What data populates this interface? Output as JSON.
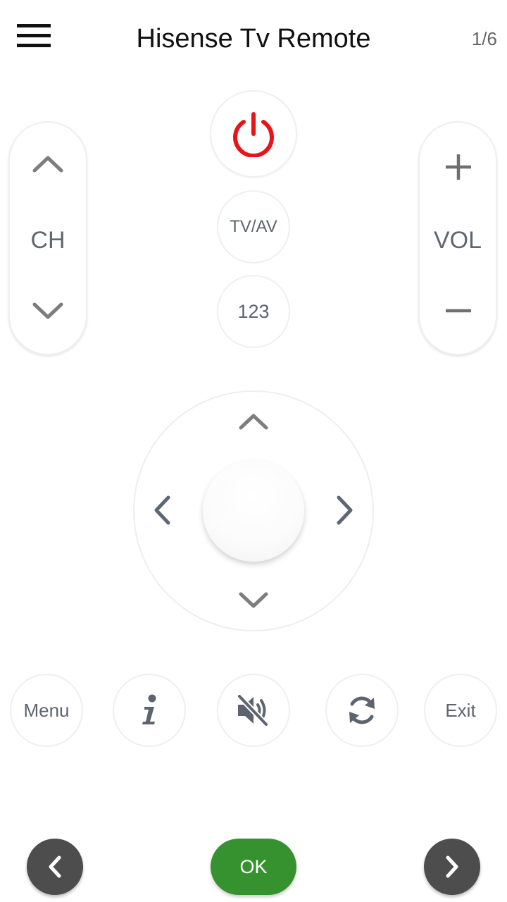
{
  "header": {
    "title": "Hisense Tv Remote",
    "page_indicator": "1/6",
    "menu_icon": "hamburger-icon"
  },
  "channel": {
    "label": "CH",
    "up_icon": "chevron-up-icon",
    "down_icon": "chevron-down-icon"
  },
  "volume": {
    "label": "VOL",
    "up_icon": "plus-icon",
    "down_icon": "minus-icon"
  },
  "center_buttons": {
    "power_icon": "power-icon",
    "power_color": "#e8141a",
    "tvav_label": "TV/AV",
    "numbers_label": "123"
  },
  "dpad": {
    "up_icon": "chevron-up-icon",
    "down_icon": "chevron-down-icon",
    "left_icon": "chevron-left-icon",
    "right_icon": "chevron-right-icon",
    "center_icon": "ok-center-button"
  },
  "function_row": {
    "menu_label": "Menu",
    "info_icon": "info-icon",
    "mute_icon": "mute-icon",
    "refresh_icon": "refresh-icon",
    "exit_label": "Exit"
  },
  "bottom_nav": {
    "prev_icon": "chevron-left-icon",
    "ok_label": "OK",
    "next_icon": "chevron-right-icon",
    "ok_color": "#35922f",
    "nav_color": "#4d4d4d"
  }
}
